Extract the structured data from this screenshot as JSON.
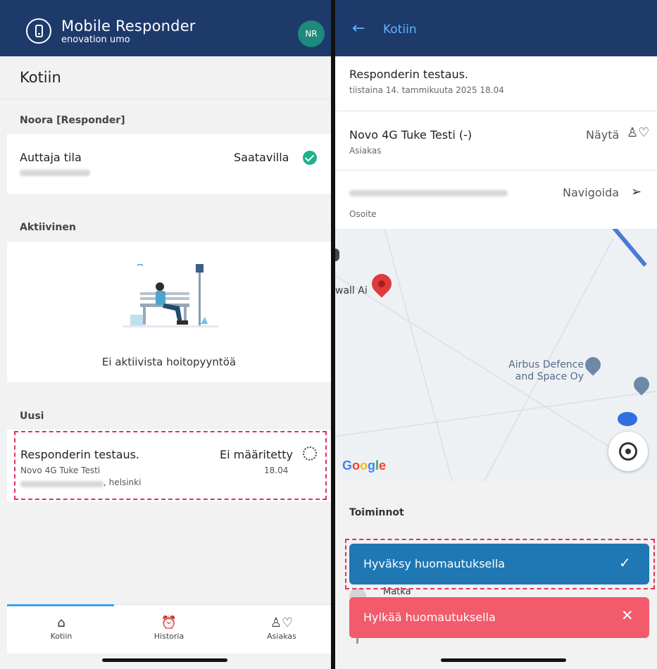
{
  "left": {
    "app": {
      "title": "Mobile Responder",
      "subtitle": "enovation umo",
      "avatar": "NR"
    },
    "page_title": "Kotiin",
    "user_section": "Noora [Responder]",
    "status_row": {
      "label": "Auttaja tila",
      "value": "Saatavilla",
      "icon": "check-circle-icon"
    },
    "active_section": "Aktiivinen",
    "empty_message": "Ei aktiivista hoitopyyntöä",
    "new_section": "Uusi",
    "request": {
      "title": "Responderin testaus.",
      "status": "Ei määritetty",
      "customer": "Novo 4G  Tuke Testi",
      "time": "18.04",
      "city": ", helsinki"
    },
    "nav": [
      {
        "label": "Kotiin",
        "icon": "home-icon"
      },
      {
        "label": "Historia",
        "icon": "alarm-clock-icon"
      },
      {
        "label": "Asiakas",
        "icon": "person-heart-icon"
      }
    ]
  },
  "right": {
    "header_title": "Kotiin",
    "event": {
      "title": "Responderin testaus.",
      "date": "tiistaina 14. tammikuuta 2025 18.04"
    },
    "customer_row": {
      "name": "Novo 4G  Tuke Testi (-)",
      "label": "Asiakas",
      "action": "Näytä"
    },
    "address_row": {
      "label": "Osoite",
      "action": "Navigoida"
    },
    "map": {
      "poi_left": "wall Ai",
      "poi_airbus": "Airbus Defence and Space Oy",
      "logo": "Google"
    },
    "actions_title": "Toiminnot",
    "accept_button": "Hyväksy huomautuksella",
    "behind_label": "Matka",
    "reject_button": "Hylkää huomautuksella"
  },
  "colors": {
    "appbar": "#1d3a6b",
    "accent": "#5fb4ff",
    "accept": "#1f78b4",
    "reject": "#f25b6c",
    "available": "#1bb38a",
    "highlight": "#e0325a"
  }
}
